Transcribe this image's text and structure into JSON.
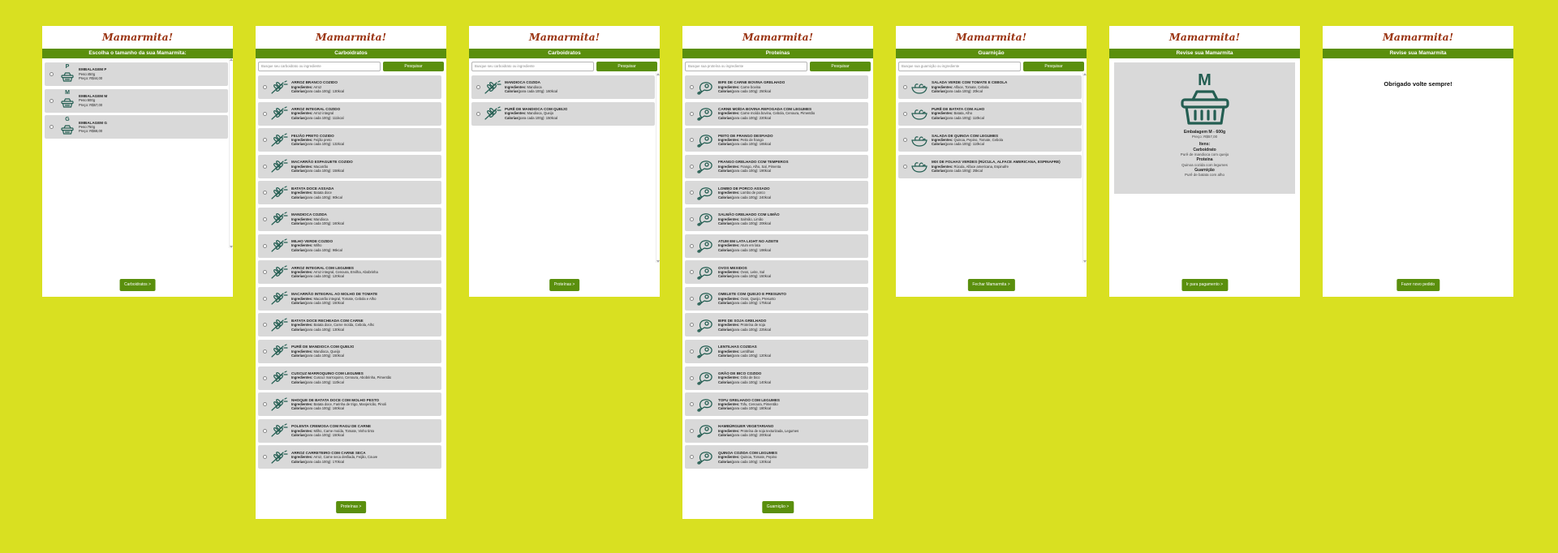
{
  "brand": "Mamarmita!",
  "colors": {
    "background": "#d9e021",
    "accent": "#5a8f0d",
    "brand": "#9a3412",
    "icon": "#245e52",
    "card": "#d9d9d9"
  },
  "screens": {
    "size": {
      "header": "Escolha o tamanho da sua Mamarmita:",
      "items": [
        {
          "letter": "P",
          "title": "EMBALAGEM P",
          "weight": "Peso:450g",
          "price": "Preço: R$44,00"
        },
        {
          "letter": "M",
          "title": "EMBALAGEM M",
          "weight": "Peso:600g",
          "price": "Preço: R$57,00"
        },
        {
          "letter": "G",
          "title": "EMBALAGEM G",
          "weight": "Peso:750g",
          "price": "Preço: R$68,00"
        }
      ],
      "next": "Carboidratos >"
    },
    "carbs": {
      "header": "Carboidratos",
      "search_placeholder": "Busque seu carboidrato ou ingrediente",
      "search_button": "Pesquisar",
      "ing_label": "Ingredientes:",
      "cal_label": "Calorias",
      "items": [
        {
          "name": "ARROZ BRANCO COZIDO",
          "ing": "Arroz",
          "cal": "(para cada 100g): 130kcal"
        },
        {
          "name": "ARROZ INTEGRAL COZIDO",
          "ing": "Arroz integral",
          "cal": "(para cada 100g): 111kcal"
        },
        {
          "name": "FEIJÃO PRETO COZIDO",
          "ing": "Feijão preto",
          "cal": "(para cada 100g): 132kcal"
        },
        {
          "name": "MACARRÃO ESPAGUETE COZIDO",
          "ing": "Macarrão",
          "cal": "(para cada 100g): 158kcal"
        },
        {
          "name": "BATATA DOCE ASSADA",
          "ing": "Batata doce",
          "cal": "(para cada 100g): 90kcal"
        },
        {
          "name": "MANDIOCA COZIDA",
          "ing": "Mandioca",
          "cal": "(para cada 100g): 160kcal"
        },
        {
          "name": "MILHO VERDE COZIDO",
          "ing": "Milho",
          "cal": "(para cada 100g): 96kcal"
        },
        {
          "name": "ARROZ INTEGRAL COM LEGUMES",
          "ing": "Arroz integral, Cenoura, Ervilha, Abobrinha",
          "cal": "(para cada 100g): 120kcal"
        },
        {
          "name": "MACARRÃO INTEGRAL AO MOLHO DE TOMATE",
          "ing": "Macarrão integral, Tomate, Cebola e Alho",
          "cal": "(para cada 100g): 150kcal"
        },
        {
          "name": "BATATA DOCE RECHEADA COM CARNE",
          "ing": "Batata doce, Carne moída, Cebola, Alho",
          "cal": "(para cada 100g): 130kcal"
        },
        {
          "name": "PURÊ DE MANDIOCA COM QUEIJO",
          "ing": "Mandioca, Queijo",
          "cal": "(para cada 100g): 150kcal"
        },
        {
          "name": "CUSCUZ MARROQUINO COM LEGUMES",
          "ing": "Cuscuz marroquino, Cenoura, Abobrinha, Pimentão",
          "cal": "(para cada 100g): 110kcal"
        },
        {
          "name": "NHOQUE DE BATATA DOCE COM MOLHO PESTO",
          "ing": "Batata doce, Farinha de trigo, Manjericão, Pinoli",
          "cal": "(para cada 100g): 160kcal"
        },
        {
          "name": "POLENTA CREMOSA COM RAGU DE CARNE",
          "ing": "Milho, Carne moída, Tomate, Vinho tinto",
          "cal": "(para cada 100g): 150kcal"
        },
        {
          "name": "ARROZ CARRETEIRO COM CARNE SECA",
          "ing": "Arroz, Carne seca desfiada, Feijão, Couve",
          "cal": "(para cada 100g): 170kcal"
        }
      ],
      "next": "Proteínas >"
    },
    "carbs_filtered": {
      "header": "Carboidratos",
      "search_placeholder": "Busque seu carboidrato ou ingrediente",
      "search_button": "Pesquisar",
      "items": [
        {
          "name": "MANDIOCA COZIDA",
          "ing": "Mandioca",
          "cal": "(para cada 100g): 160kcal"
        },
        {
          "name": "PURÊ DE MANDIOCA COM QUEIJO",
          "ing": "Mandioca, Queijo",
          "cal": "(para cada 100g): 150kcal"
        }
      ],
      "next": "Proteínas >"
    },
    "proteins": {
      "header": "Proteínas",
      "search_placeholder": "Busque sua proteína ou ingrediente",
      "search_button": "Pesquisar",
      "items": [
        {
          "name": "BIFE DE CARNE BOVINA GRELHADO",
          "ing": "Carne bovina",
          "cal": "(para cada 100g): 250kcal"
        },
        {
          "name": "CARNE MOÍDA BOVINA REFOGADA COM LEGUMES",
          "ing": "Carne moída bovina, Cebola, Cenoura, Pimentão",
          "cal": "(para cada 100g): 220kcal"
        },
        {
          "name": "PEITO DE FRANGO DESFIADO",
          "ing": "Peito de frango",
          "cal": "(para cada 100g): 165kcal"
        },
        {
          "name": "FRANGO GRELHADO COM TEMPEROS",
          "ing": "Frango, Alho, Sal, Pimenta",
          "cal": "(para cada 100g): 190kcal"
        },
        {
          "name": "LOMBO DE PORCO ASSADO",
          "ing": "Lombo de porco",
          "cal": "(para cada 100g): 240kcal"
        },
        {
          "name": "SALMÃO GRELHADO COM LIMÃO",
          "ing": "Salmão, Limão",
          "cal": "(para cada 100g): 206kcal"
        },
        {
          "name": "ATUM EM LATA LIGHT NO AZEITE",
          "ing": "Atum em lata",
          "cal": "(para cada 100g): 198kcal"
        },
        {
          "name": "OVOS MEXIDOS",
          "ing": "Ovos, Leite, Sal",
          "cal": "(para cada 100g): 150kcal"
        },
        {
          "name": "OMELETE COM QUEIJO E PRESUNTO",
          "ing": "Ovos, Queijo, Presunto",
          "cal": "(para cada 100g): 175kcal"
        },
        {
          "name": "BIFE DE SOJA GRELHADO",
          "ing": "Proteína de soja",
          "cal": "(para cada 100g): 225kcal"
        },
        {
          "name": "LENTILHAS COZIDAS",
          "ing": "Lentilhas",
          "cal": "(para cada 100g): 120kcal"
        },
        {
          "name": "GRÃO DE BICO COZIDO",
          "ing": "Grão de bico",
          "cal": "(para cada 100g): 140kcal"
        },
        {
          "name": "TOFU GRELHADO COM LEGUMES",
          "ing": "Tofu, Cenoura, Pimentão",
          "cal": "(para cada 100g): 180kcal"
        },
        {
          "name": "HAMBÚRGUER VEGETARIANO",
          "ing": "Proteína de soja texturizada, Legumes",
          "cal": "(para cada 100g): 200kcal"
        },
        {
          "name": "QUINOA COZIDA COM LEGUMES",
          "ing": "Quinoa, Tomate, Pepino",
          "cal": "(para cada 100g): 130kcal"
        }
      ],
      "next": "Guarnição >"
    },
    "sides": {
      "header": "Guarnição",
      "search_placeholder": "Busque sua guarnição ou ingrediente",
      "search_button": "Pesquisar",
      "items": [
        {
          "name": "SALADA VERDE COM TOMATE E CEBOLA",
          "ing": "Alface, Tomate, Cebola",
          "cal": "(para cada 100g): 20kcal"
        },
        {
          "name": "PURÊ DE BATATA COM ALHO",
          "ing": "Batata, Alho",
          "cal": "(para cada 100g): 110kcal"
        },
        {
          "name": "SALADA DE QUINOA COM LEGUMES",
          "ing": "Quinoa, Pepino, Tomate, Cebola",
          "cal": "(para cada 100g): 110kcal"
        },
        {
          "name": "MIX DE FOLHAS VERDES (RÚCULA, ALFACE AMERICANA, ESPINAFRE)",
          "ing": "Rúcula, Alface americana, Espinafre",
          "cal": "(para cada 100g): 25kcal"
        }
      ],
      "next": "Fechar Mamarmita >"
    },
    "review": {
      "header": "Revise sua Mamarmita",
      "letter": "M",
      "package": "Embalagem M - 600g",
      "price": "Preço: R$57,00",
      "items_label": "Itens:",
      "sections": [
        {
          "title": "Carboidrato",
          "value": "Purê de mandioca com queijo"
        },
        {
          "title": "Proteína",
          "value": "Quinoa cozida com legumes"
        },
        {
          "title": "Guarnição",
          "value": "Purê de batata com alho"
        }
      ],
      "next": "Ir para pagamento >"
    },
    "thanks": {
      "header": "Revise sua Mamarmita",
      "message": "Obrigado volte sempre!",
      "button": "Fazer novo pedido"
    }
  }
}
